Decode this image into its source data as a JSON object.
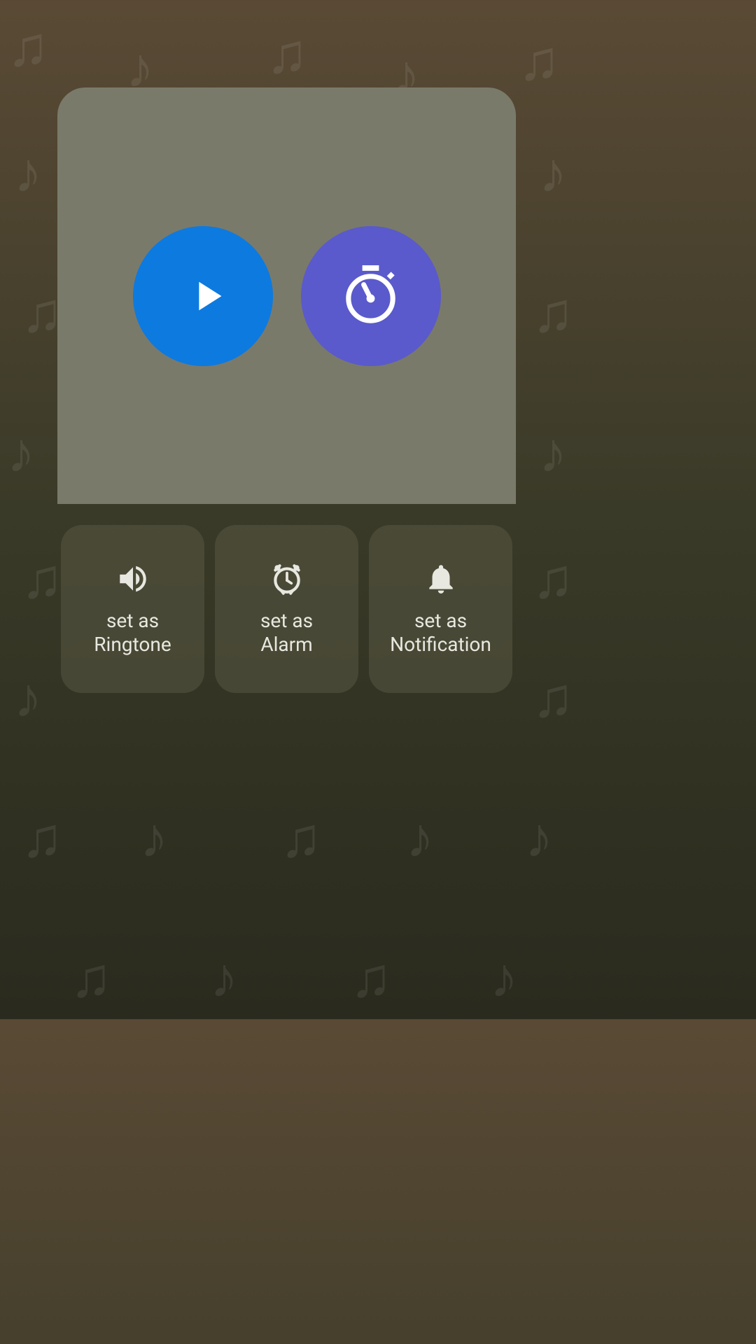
{
  "actions": {
    "ringtone": {
      "label": "set as\nRingtone"
    },
    "alarm": {
      "label": "set as\nAlarm"
    },
    "notification": {
      "label": "set as\nNotification"
    }
  },
  "icons": {
    "play": "play-icon",
    "timer": "stopwatch-icon",
    "speaker": "speaker-icon",
    "alarm_clock": "alarm-clock-icon",
    "bell": "bell-icon"
  },
  "colors": {
    "play_button": "#0d7ae0",
    "timer_button": "#5a5acc",
    "panel_bg": "#7a7a6a",
    "card_bg": "rgba(90, 90, 70, 0.5)"
  }
}
